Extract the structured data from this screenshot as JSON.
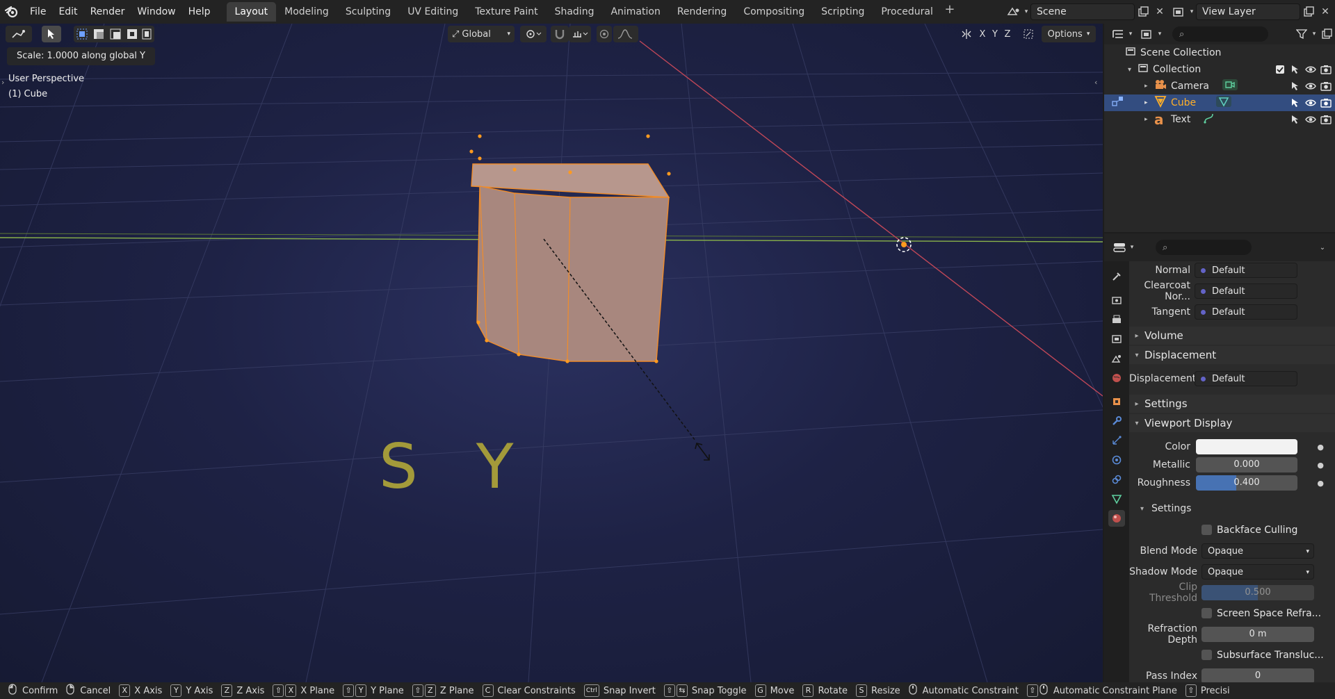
{
  "topbar": {
    "menus": [
      "File",
      "Edit",
      "Render",
      "Window",
      "Help"
    ],
    "workspaces": [
      "Layout",
      "Modeling",
      "Sculpting",
      "UV Editing",
      "Texture Paint",
      "Shading",
      "Animation",
      "Rendering",
      "Compositing",
      "Scripting",
      "Procedural"
    ],
    "active_workspace": "Layout",
    "scene": "Scene",
    "view_layer": "View Layer"
  },
  "viewport": {
    "transform_orientation": "Global",
    "axes": [
      "X",
      "Y",
      "Z"
    ],
    "options_label": "Options",
    "operator_text": "Scale: 1.0000 along global Y",
    "perspective": "User Perspective",
    "object_info": "(1) Cube",
    "scene_text": "S   Y"
  },
  "outliner": {
    "scene_collection": "Scene Collection",
    "collection": "Collection",
    "items": [
      {
        "name": "Camera"
      },
      {
        "name": "Cube"
      },
      {
        "name": "Text"
      }
    ]
  },
  "properties": {
    "normal_label": "Normal",
    "normal_value": "Default",
    "clearcoat_label": "Clearcoat Nor...",
    "clearcoat_value": "Default",
    "tangent_label": "Tangent",
    "tangent_value": "Default",
    "volume_header": "Volume",
    "displacement_header": "Displacement",
    "displacement_label": "Displacement",
    "displacement_value": "Default",
    "settings_header": "Settings",
    "viewport_display_header": "Viewport Display",
    "color_label": "Color",
    "metallic_label": "Metallic",
    "metallic_value": "0.000",
    "roughness_label": "Roughness",
    "roughness_value": "0.400",
    "roughness_fraction": 0.4,
    "sub_settings_header": "Settings",
    "backface_culling": "Backface Culling",
    "blend_mode_label": "Blend Mode",
    "blend_mode_value": "Opaque",
    "shadow_mode_label": "Shadow Mode",
    "shadow_mode_value": "Opaque",
    "clip_threshold_label": "Clip Threshold",
    "clip_threshold_value": "0.500",
    "screen_space_refraction": "Screen Space Refra...",
    "refraction_depth_label": "Refraction Depth",
    "refraction_depth_value": "0 m",
    "subsurface_translucency": "Subsurface Transluc...",
    "pass_index_label": "Pass Index",
    "pass_index_value": "0"
  },
  "statusbar": {
    "confirm": "Confirm",
    "cancel": "Cancel",
    "x_axis": "X Axis",
    "y_axis": "Y Axis",
    "z_axis": "Z Axis",
    "x_plane": "X Plane",
    "y_plane": "Y Plane",
    "z_plane": "Z Plane",
    "clear_constraints": "Clear Constraints",
    "snap_invert": "Snap Invert",
    "snap_toggle": "Snap Toggle",
    "move": "Move",
    "rotate": "Rotate",
    "resize": "Resize",
    "automatic_constraint": "Automatic Constraint",
    "automatic_constraint_plane": "Automatic Constraint Plane",
    "precision": "Precisi",
    "keys": {
      "x": "X",
      "y": "Y",
      "z": "Z",
      "shift": "⇧",
      "c": "C",
      "ctrl": "Ctrl",
      "g": "G",
      "r": "R",
      "s": "S"
    }
  },
  "colors": {
    "selected_orange": "#ffaf29",
    "header_bg": "#232323",
    "panel_bg": "#2b2b2b",
    "selection_blue": "#334d80",
    "roughness_fill": "#4772b3"
  }
}
